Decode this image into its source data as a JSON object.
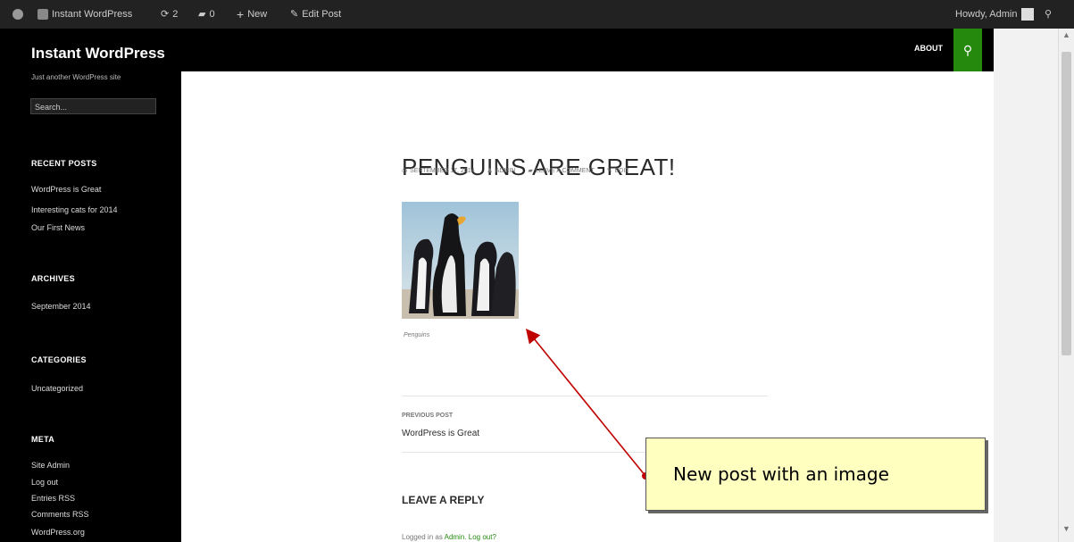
{
  "admin_bar": {
    "site_name": "Instant WordPress",
    "updates_count": "2",
    "comments_count": "0",
    "new_label": "New",
    "edit_post_label": "Edit Post",
    "howdy": "Howdy, Admin"
  },
  "header": {
    "site_title": "Instant WordPress",
    "tagline": "Just another WordPress site",
    "nav_about": "ABOUT"
  },
  "sidebar": {
    "search_placeholder": "Search...",
    "recent_posts_title": "RECENT POSTS",
    "recent_posts": [
      "WordPress is Great",
      "Interesting cats for 2014",
      "Our First News"
    ],
    "archives_title": "ARCHIVES",
    "archives": [
      "September 2014"
    ],
    "categories_title": "CATEGORIES",
    "categories": [
      "Uncategorized"
    ],
    "meta_title": "META",
    "meta_items": [
      "Site Admin",
      "Log out",
      "Entries RSS",
      "Comments RSS",
      "WordPress.org"
    ]
  },
  "post": {
    "title": "PENGUINS ARE GREAT!",
    "date": "SEPTEMBER 17, 2014",
    "author": "ADMIN",
    "leave_comment": "LEAVE A COMMENT",
    "edit": "EDIT",
    "image_caption": "Penguins"
  },
  "navigation": {
    "previous_label": "PREVIOUS POST",
    "previous_title": "WordPress is Great"
  },
  "comments": {
    "reply_title": "LEAVE A REPLY",
    "logged_in_prefix": "Logged in as",
    "logged_in_user": "Admin",
    "log_out": "Log out?"
  },
  "annotation": {
    "callout_text": "New post with an image",
    "arrow_color": "#c00000"
  },
  "colors": {
    "accent_green": "#24890d",
    "callout_bg": "#ffffc0"
  }
}
